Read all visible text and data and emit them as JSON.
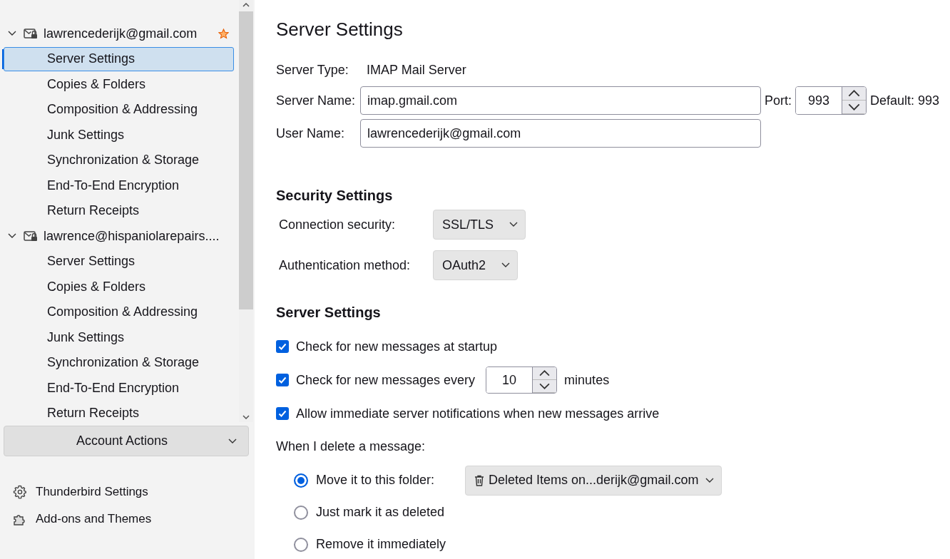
{
  "sidebar": {
    "accounts": [
      {
        "name": "lawrencederijk@gmail.com",
        "expanded": true,
        "default": true,
        "children": [
          {
            "label": "Server Settings",
            "selected": true
          },
          {
            "label": "Copies & Folders",
            "selected": false
          },
          {
            "label": "Composition & Addressing",
            "selected": false
          },
          {
            "label": "Junk Settings",
            "selected": false
          },
          {
            "label": "Synchronization & Storage",
            "selected": false
          },
          {
            "label": "End-To-End Encryption",
            "selected": false
          },
          {
            "label": "Return Receipts",
            "selected": false
          }
        ]
      },
      {
        "name": "lawrence@hispaniolarepairs....",
        "expanded": true,
        "default": false,
        "children": [
          {
            "label": "Server Settings",
            "selected": false
          },
          {
            "label": "Copies & Folders",
            "selected": false
          },
          {
            "label": "Composition & Addressing",
            "selected": false
          },
          {
            "label": "Junk Settings",
            "selected": false
          },
          {
            "label": "Synchronization & Storage",
            "selected": false
          },
          {
            "label": "End-To-End Encryption",
            "selected": false
          },
          {
            "label": "Return Receipts",
            "selected": false
          }
        ]
      }
    ],
    "account_actions": "Account Actions",
    "footer": [
      {
        "kind": "settings",
        "label": "Thunderbird Settings"
      },
      {
        "kind": "addons",
        "label": "Add-ons and Themes"
      }
    ]
  },
  "main": {
    "title": "Server Settings",
    "server_type": {
      "label": "Server Type:",
      "value": "IMAP Mail Server"
    },
    "server_name": {
      "label": "Server Name:",
      "value": "imap.gmail.com"
    },
    "port": {
      "label": "Port:",
      "value": "993",
      "default": "Default: 993"
    },
    "user_name": {
      "label": "User Name:",
      "value": "lawrencederijk@gmail.com"
    },
    "security": {
      "heading": "Security Settings",
      "fields": [
        {
          "label": "Connection security:",
          "value": "SSL/TLS"
        },
        {
          "label": "Authentication method:",
          "value": "OAuth2"
        }
      ]
    },
    "server": {
      "heading": "Server Settings",
      "options": [
        {
          "kind": "check",
          "label": "Check for new messages at startup",
          "checked": true
        },
        {
          "kind": "interval",
          "label": "Check for new messages every",
          "checked": true,
          "value": "10",
          "unit": "minutes"
        },
        {
          "kind": "check",
          "label": "Allow immediate server notifications when new messages arrive",
          "checked": true
        }
      ]
    },
    "delete": {
      "label": "When I delete a message:",
      "options": [
        {
          "label": "Move it to this folder:",
          "selected": true,
          "folder": "Deleted Items on...derijk@gmail.com"
        },
        {
          "label": "Just mark it as deleted",
          "selected": false
        },
        {
          "label": "Remove it immediately",
          "selected": false
        }
      ]
    }
  }
}
